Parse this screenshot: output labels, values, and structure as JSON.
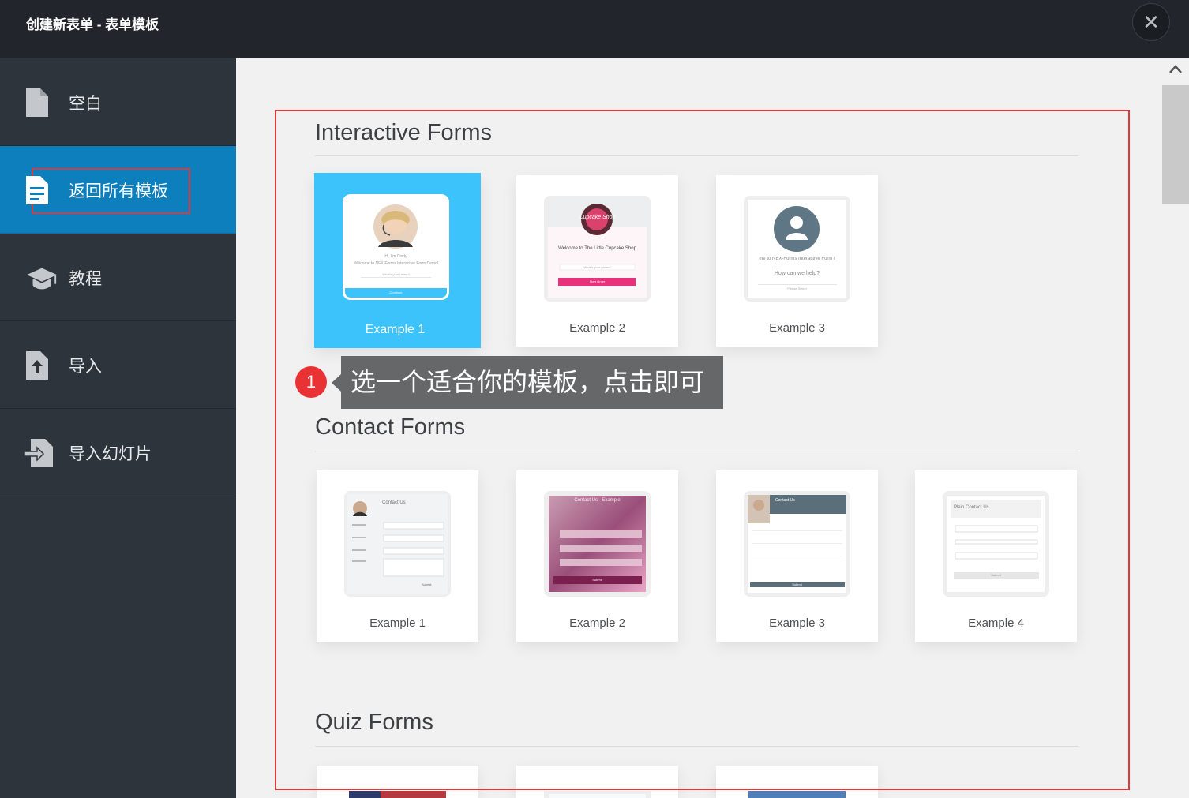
{
  "window": {
    "title": "创建新表单 - 表单模板",
    "close_label": "✕"
  },
  "sidebar": {
    "items": [
      {
        "label": "空白",
        "icon": "document-icon"
      },
      {
        "label": "返回所有模板",
        "icon": "template-icon",
        "active": true
      },
      {
        "label": "教程",
        "icon": "graduation-cap-icon"
      },
      {
        "label": "导入",
        "icon": "file-upload-icon"
      },
      {
        "label": "导入幻灯片",
        "icon": "file-import-icon"
      }
    ]
  },
  "sections": [
    {
      "title": "Interactive Forms",
      "cards": [
        {
          "label": "Example 1",
          "selected": true
        },
        {
          "label": "Example 2"
        },
        {
          "label": "Example 3"
        }
      ]
    },
    {
      "title": "Contact Forms",
      "cards": [
        {
          "label": "Example 1"
        },
        {
          "label": "Example 2"
        },
        {
          "label": "Example 3"
        },
        {
          "label": "Example 4"
        }
      ]
    },
    {
      "title": "Quiz Forms",
      "cards": [
        {},
        {},
        {}
      ]
    }
  ],
  "thumbnails": {
    "interactive_1": {
      "line1": "Hi, I'm Cindy",
      "line2": "Welcome to NEX-Forms Interactive Form Demo!",
      "field": "What's your name?",
      "button": "Continue"
    },
    "interactive_2": {
      "logo": "Cupcake Shop",
      "heading": "Welcome to The Little Cupcake Shop",
      "field": "What's your name?",
      "button": "Start Order"
    },
    "interactive_3": {
      "heading": "me to NEX-Forms Interactive Form I",
      "question": "How can we help?",
      "field": "Please Select"
    },
    "contact_1": {
      "heading": "Contact Us",
      "button": "Submit"
    },
    "contact_2": {
      "heading": "Contact Us - Example",
      "button": "Submit"
    },
    "contact_3": {
      "heading": "Contact Us",
      "button": "Submit"
    },
    "contact_4": {
      "heading": "Plain Contact Us",
      "button": "Submit"
    }
  },
  "tooltip": {
    "number": "1",
    "text": "选一个适合你的模板，点击即可"
  },
  "colors": {
    "titlebar": "#22262c",
    "sidebar": "#2e343c",
    "active": "#0d7fbd",
    "selected_card": "#3cc3fb",
    "highlight": "#e0393b"
  }
}
